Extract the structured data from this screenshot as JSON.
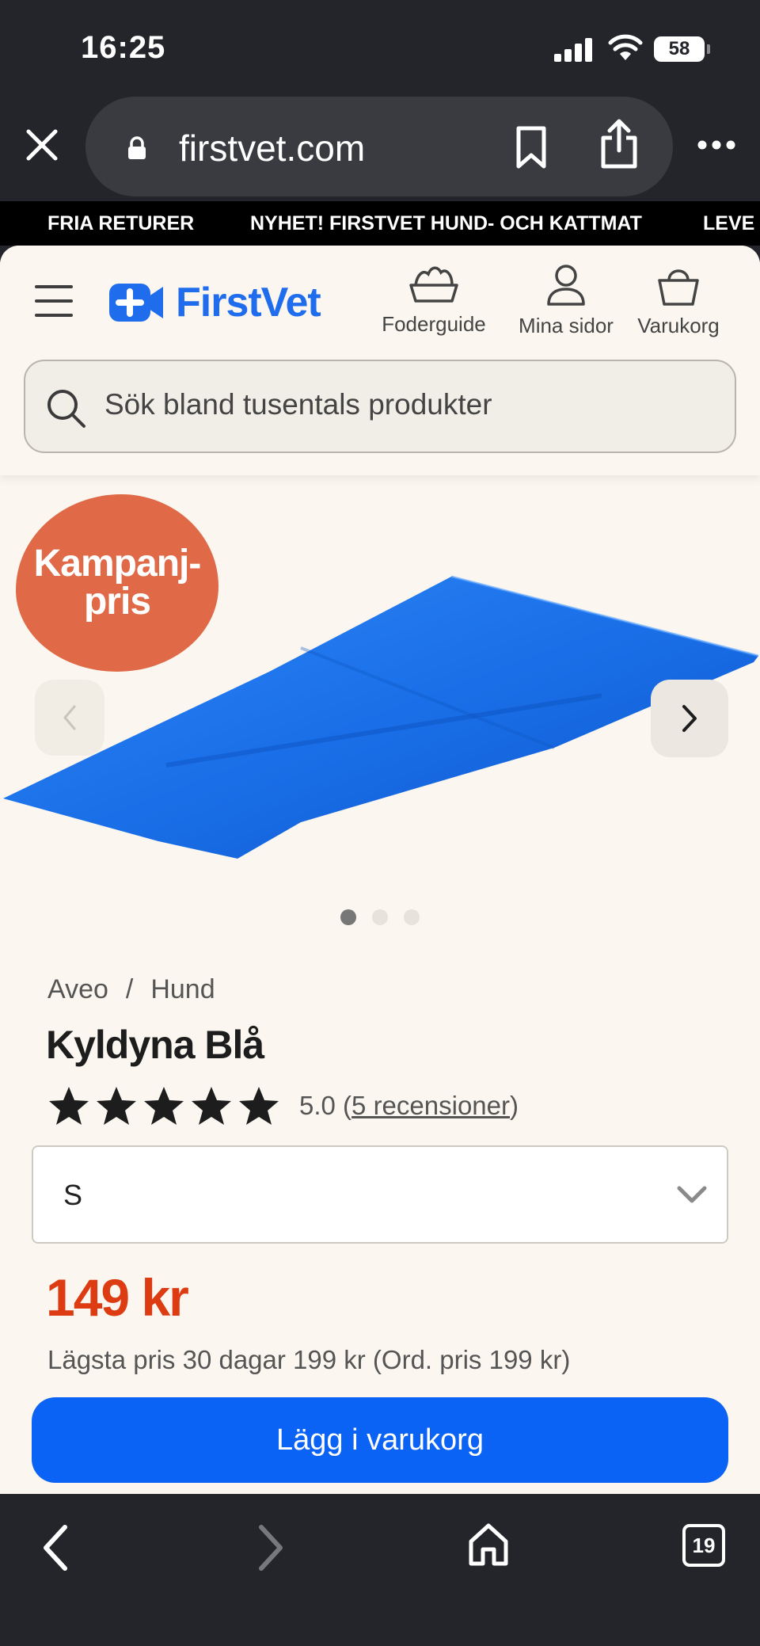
{
  "status_bar": {
    "time": "16:25",
    "battery": "58"
  },
  "browser": {
    "url": "firstvet.com",
    "tab_count": "19"
  },
  "marquee": [
    "FRIA RETURER",
    "NYHET! FIRSTVET HUND- OCH KATTMAT",
    "LEVE"
  ],
  "header": {
    "logo_text": "FirstVet",
    "nav": [
      {
        "label": "Foderguide",
        "icon": "food-bowl-icon"
      },
      {
        "label": "Mina sidor",
        "icon": "user-icon"
      },
      {
        "label": "Varukorg",
        "icon": "basket-icon"
      }
    ],
    "search_placeholder": "Sök bland tusentals produkter"
  },
  "gallery": {
    "badge": [
      "Kampanj-",
      "pris"
    ],
    "dots_total": 3,
    "active_dot": 0
  },
  "product": {
    "breadcrumb": [
      "Aveo",
      "Hund"
    ],
    "breadcrumb_separator": "/",
    "title": "Kyldyna Blå",
    "rating": 5.0,
    "rating_text": "5.0",
    "reviews_link": "5 recensioner",
    "size": "S",
    "price": "149 kr",
    "price_note": "Lägsta pris 30 dagar 199 kr (Ord. pris 199 kr)",
    "add_to_cart": "Lägg i varukorg"
  },
  "colors": {
    "brand_blue": "#1f6ded",
    "cta_blue": "#0a63f5",
    "price_red": "#dd3c12",
    "badge_orange": "#e06a47",
    "mat_blue": "#1a6fe8",
    "page_bg": "#fbf7f0",
    "chrome_bg": "#24252b"
  }
}
